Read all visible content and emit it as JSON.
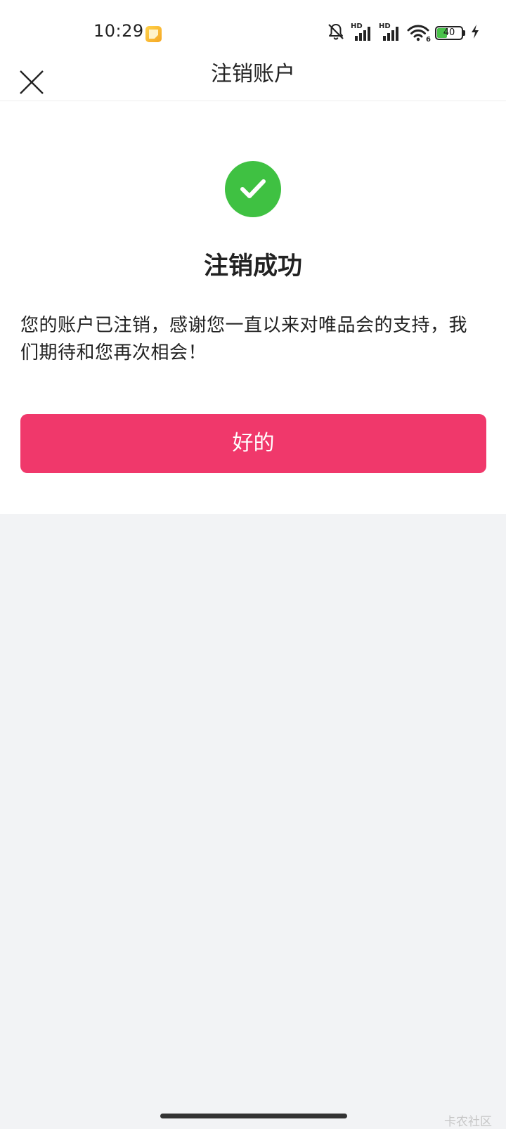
{
  "status_bar": {
    "time": "10:29",
    "battery_level": "40",
    "battery_fraction": 0.4,
    "icons": [
      "app-notification-icon",
      "bell-off-icon",
      "hd-signal-icon",
      "hd-signal-icon",
      "wifi-icon",
      "battery-icon",
      "charging-icon"
    ],
    "signal_label_1": "HD",
    "signal_label_2": "HD",
    "wifi_label": "6"
  },
  "nav": {
    "title": "注销账户",
    "close_icon": "close-icon"
  },
  "content": {
    "success_icon": "check-circle-icon",
    "title": "注销成功",
    "message": "您的账户已注销，感谢您一直以来对唯品会的支持，我们期待和您再次相会！",
    "ok_label": "好的"
  },
  "watermark": "卡农社区",
  "colors": {
    "accent": "#f0386b",
    "success": "#3fc142",
    "page_bg": "#f2f3f5"
  }
}
